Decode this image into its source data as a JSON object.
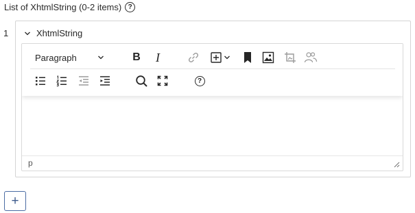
{
  "list": {
    "title": "List of XhtmlString (0-2 items)",
    "help_glyph": "?"
  },
  "item": {
    "index": "1",
    "name": "XhtmlString",
    "expanded": true
  },
  "editor": {
    "block_format": "Paragraph",
    "status_path": "p",
    "toolbar_row1": [
      "bold-icon",
      "italic-icon",
      "link-icon",
      "insert-icon",
      "chevron-down-icon",
      "bookmark-icon",
      "image-icon",
      "image-crop-icon",
      "personalization-icon"
    ],
    "toolbar_row2": [
      "bullet-list-icon",
      "numbered-list-icon",
      "outdent-icon",
      "indent-icon",
      "search-icon",
      "fullscreen-icon",
      "help-icon"
    ],
    "bold_glyph": "B",
    "italic_glyph": "I",
    "help_glyph": "?"
  },
  "add_button": {
    "label": "+"
  },
  "colors": {
    "border": "#d4d4d4",
    "accent": "#3d5a8c",
    "icon": "#262626",
    "disabled_icon": "#9a9a9a"
  }
}
